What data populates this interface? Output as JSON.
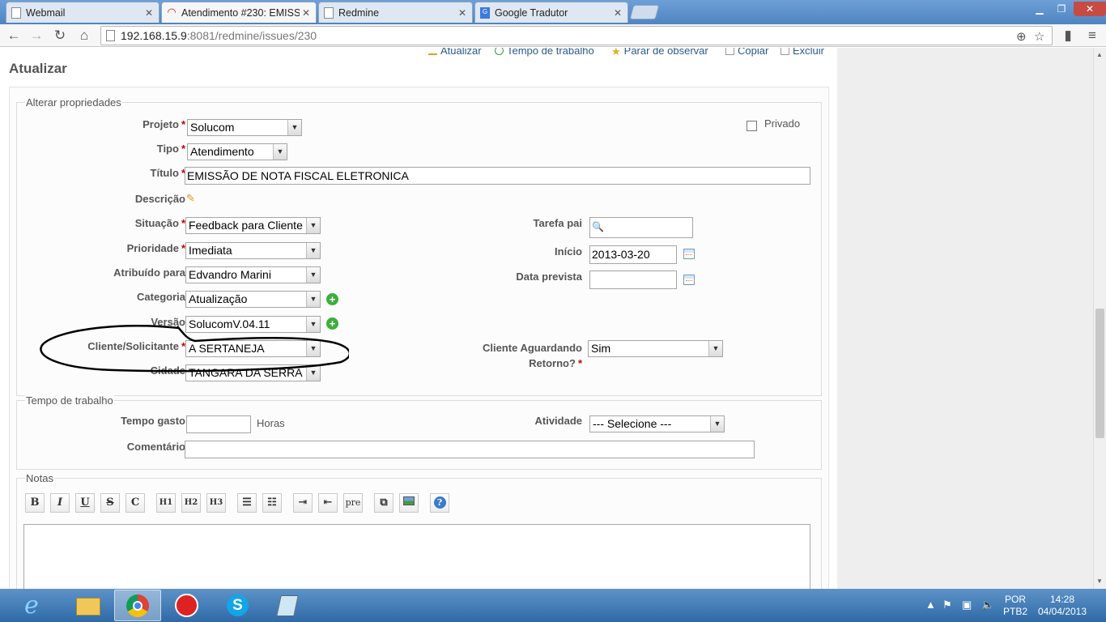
{
  "browser": {
    "tabs": [
      {
        "label": "Webmail",
        "active": false
      },
      {
        "label": "Atendimento #230: EMISS",
        "active": true
      },
      {
        "label": "Redmine",
        "active": false
      },
      {
        "label": "Google Tradutor",
        "active": false
      }
    ],
    "url_host": "192.168.15.9",
    "url_rest": ":8081/redmine/issues/230",
    "icons": [
      "back-icon",
      "forward-icon",
      "reload-icon",
      "home-icon",
      "zoom-icon",
      "star-icon",
      "extension-icon",
      "menu-icon"
    ]
  },
  "contextual": {
    "update": "Atualizar",
    "log_time": "Tempo de trabalho",
    "unwatch": "Parar de observar",
    "copy": "Copiar",
    "delete": "Excluir"
  },
  "page_title": "Atualizar",
  "properties": {
    "legend": "Alterar propriedades",
    "project_label": "Projeto",
    "project_value": "Solucom",
    "private_label": "Privado",
    "tracker_label": "Tipo",
    "tracker_value": "Atendimento",
    "subject_label": "Título",
    "subject_value": "EMISSÃO DE NOTA FISCAL ELETRONICA",
    "description_label": "Descrição",
    "status_label": "Situação",
    "status_value": "Feedback para Cliente",
    "priority_label": "Prioridade",
    "priority_value": "Imediata",
    "assignee_label": "Atribuído para",
    "assignee_value": "Edvandro Marini",
    "category_label": "Categoria",
    "category_value": "Atualização",
    "version_label": "Versão",
    "version_value": "SolucomV.04.11",
    "client_label": "Cliente/Solicitante",
    "client_value": "A SERTANEJA",
    "city_label": "Cidade",
    "city_value": "TANGARA DA SERRA",
    "parent_label": "Tarefa pai",
    "start_label": "Início",
    "start_value": "2013-03-20",
    "due_label": "Data prevista",
    "awaiting_label_1": "Cliente Aguardando",
    "awaiting_label_2": "Retorno?",
    "awaiting_value": "Sim"
  },
  "time": {
    "legend": "Tempo de trabalho",
    "spent_label": "Tempo gasto",
    "hours": "Horas",
    "activity_label": "Atividade",
    "activity_value": "--- Selecione ---",
    "comment_label": "Comentário"
  },
  "notes": {
    "legend": "Notas",
    "toolbar": [
      "B",
      "I",
      "U",
      "S",
      "C",
      "H1",
      "H2",
      "H3",
      "ul",
      "ol",
      "indent-right",
      "indent-left",
      "pre",
      "link",
      "image",
      "help"
    ]
  },
  "taskbar": {
    "lang_1": "POR",
    "lang_2": "PTB2",
    "time": "14:28",
    "date": "04/04/2013"
  }
}
